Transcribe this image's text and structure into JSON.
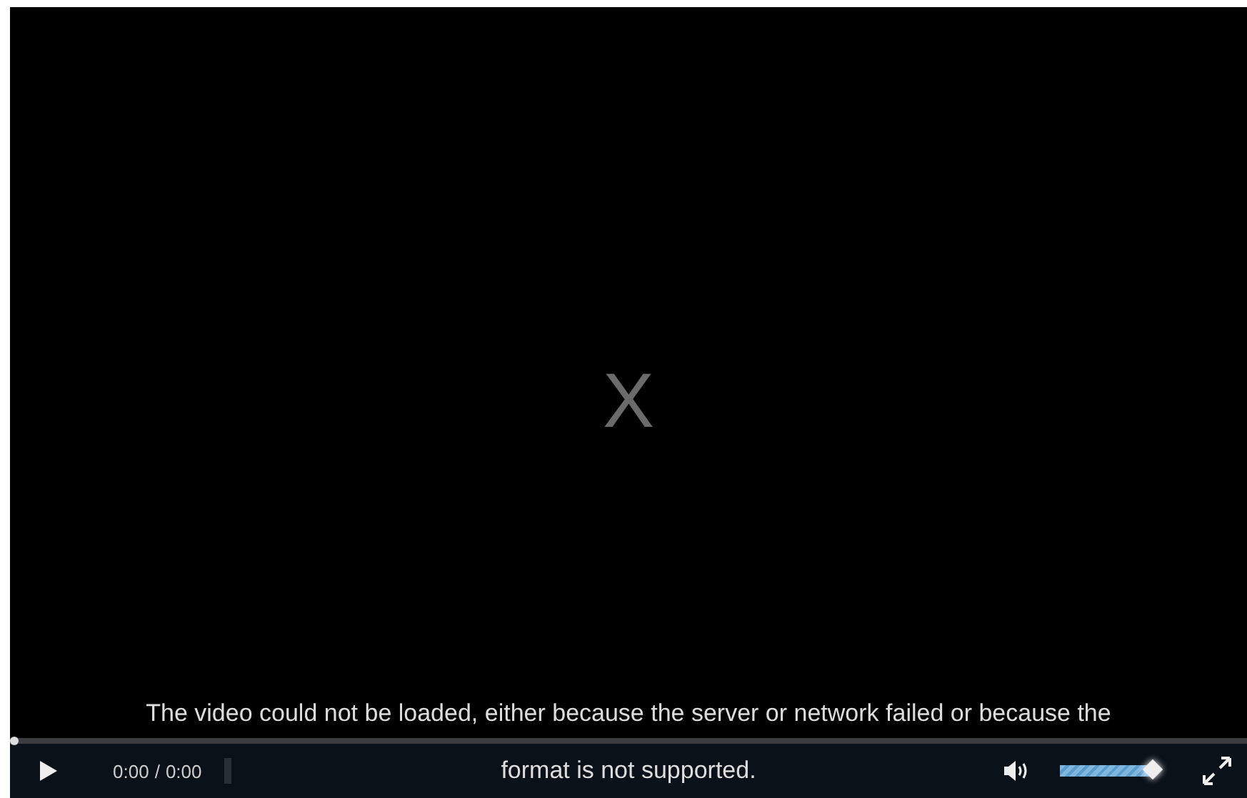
{
  "player": {
    "error_symbol": "X",
    "caption_lines": [
      "The video could not be loaded, either because the server or network failed or because the",
      "format is not supported."
    ],
    "controls": {
      "playing": false,
      "current_time": "0:00",
      "separator": "/",
      "duration": "0:00",
      "progress": {
        "level": 0
      },
      "volume": {
        "level": 1
      }
    }
  }
}
